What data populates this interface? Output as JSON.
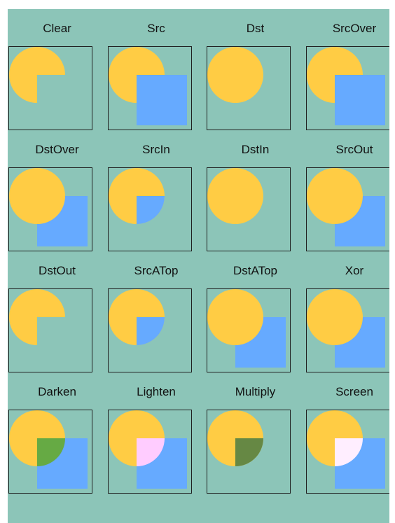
{
  "colors": {
    "background": "#8cc5b8",
    "circle": "#ffcc44",
    "square": "#66aaff",
    "frame": "#1f1f1f",
    "darken_overlap": "#66aa44",
    "lighten_overlap": "#ffccff",
    "multiply_overlap": "#668844",
    "screen_overlap": "#ffeeff"
  },
  "modes": [
    {
      "label": "Clear"
    },
    {
      "label": "Src"
    },
    {
      "label": "Dst"
    },
    {
      "label": "SrcOver"
    },
    {
      "label": "DstOver"
    },
    {
      "label": "SrcIn"
    },
    {
      "label": "DstIn"
    },
    {
      "label": "SrcOut"
    },
    {
      "label": "DstOut"
    },
    {
      "label": "SrcATop"
    },
    {
      "label": "DstATop"
    },
    {
      "label": "Xor"
    },
    {
      "label": "Darken"
    },
    {
      "label": "Lighten"
    },
    {
      "label": "Multiply"
    },
    {
      "label": "Screen"
    }
  ]
}
